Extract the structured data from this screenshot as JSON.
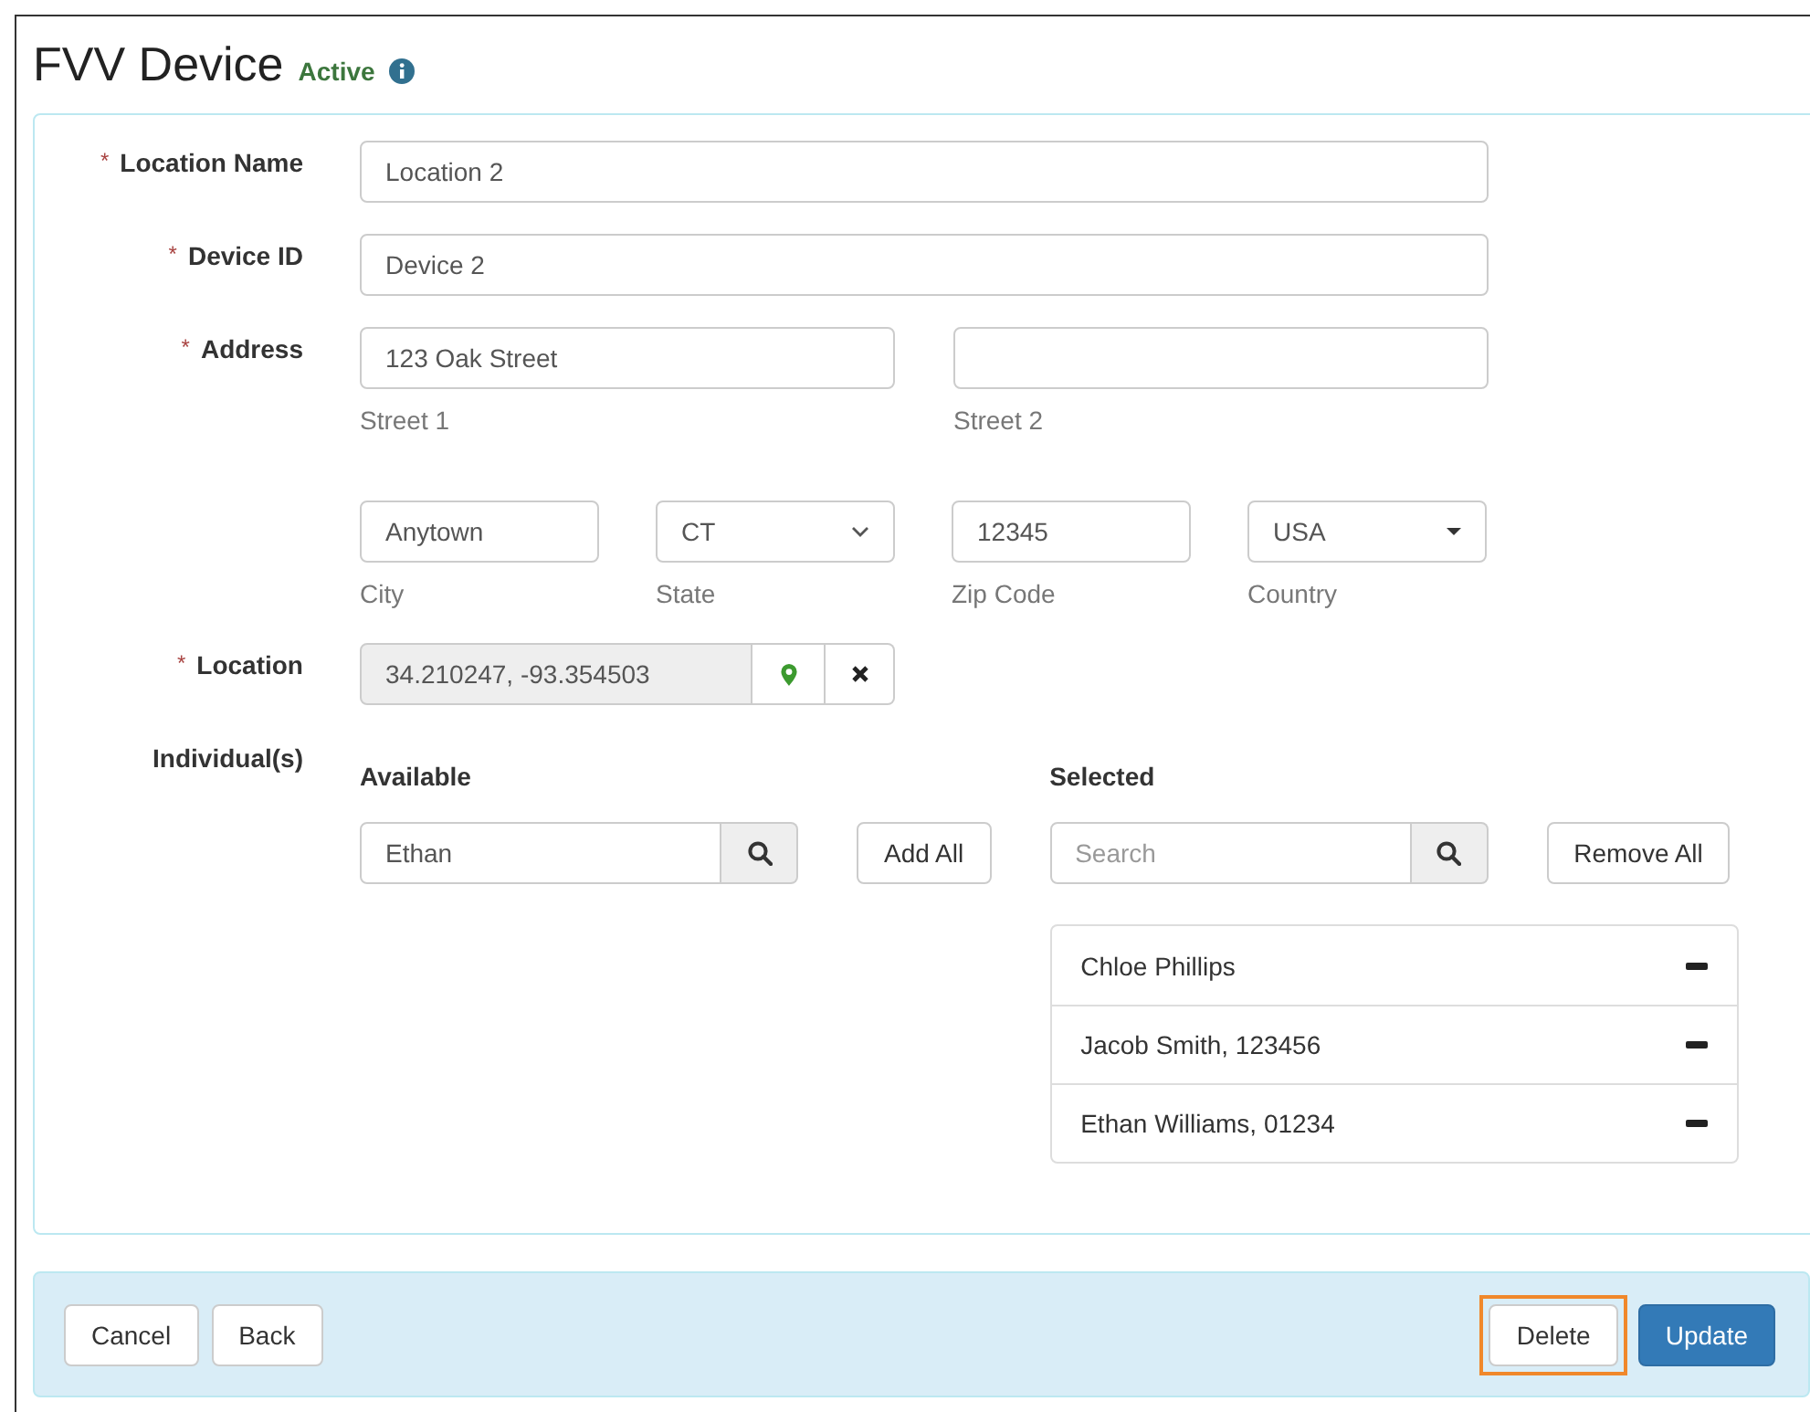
{
  "header": {
    "title": "FVV Device",
    "status": "Active"
  },
  "form": {
    "location_name": {
      "label": "Location Name",
      "required_mark": "*",
      "value": "Location 2"
    },
    "device_id": {
      "label": "Device ID",
      "required_mark": "*",
      "value": "Device 2"
    },
    "address": {
      "label": "Address",
      "required_mark": "*",
      "street": [
        {
          "value": "123 Oak Street",
          "caption": "Street 1"
        },
        {
          "caption": "Street 2"
        }
      ],
      "parts": [
        {
          "kind": "text",
          "value": "Anytown",
          "caption": "City"
        },
        {
          "kind": "select",
          "value": "CT",
          "caption": "State"
        },
        {
          "kind": "text",
          "value": "12345",
          "caption": "Zip Code"
        },
        {
          "kind": "dropdown",
          "value": "USA",
          "caption": "Country"
        }
      ]
    },
    "location": {
      "label": "Location",
      "required_mark": "*",
      "value": "34.210247, -93.354503"
    },
    "individuals": {
      "label": "Individual(s)",
      "available": {
        "heading": "Available",
        "search_value": "Ethan",
        "button": "Add All"
      },
      "selected": {
        "heading": "Selected",
        "search_placeholder": "Search",
        "button": "Remove All",
        "items": [
          {
            "name": "Chloe Phillips"
          },
          {
            "name": "Jacob Smith, 123456"
          },
          {
            "name": "Ethan Williams, 01234"
          }
        ]
      }
    }
  },
  "footer": {
    "left_buttons": [
      "Cancel",
      "Back"
    ],
    "right_buttons": [
      {
        "label": "Delete",
        "kind": "default",
        "highlighted": true
      },
      {
        "label": "Update",
        "kind": "primary",
        "highlighted": false
      }
    ]
  }
}
